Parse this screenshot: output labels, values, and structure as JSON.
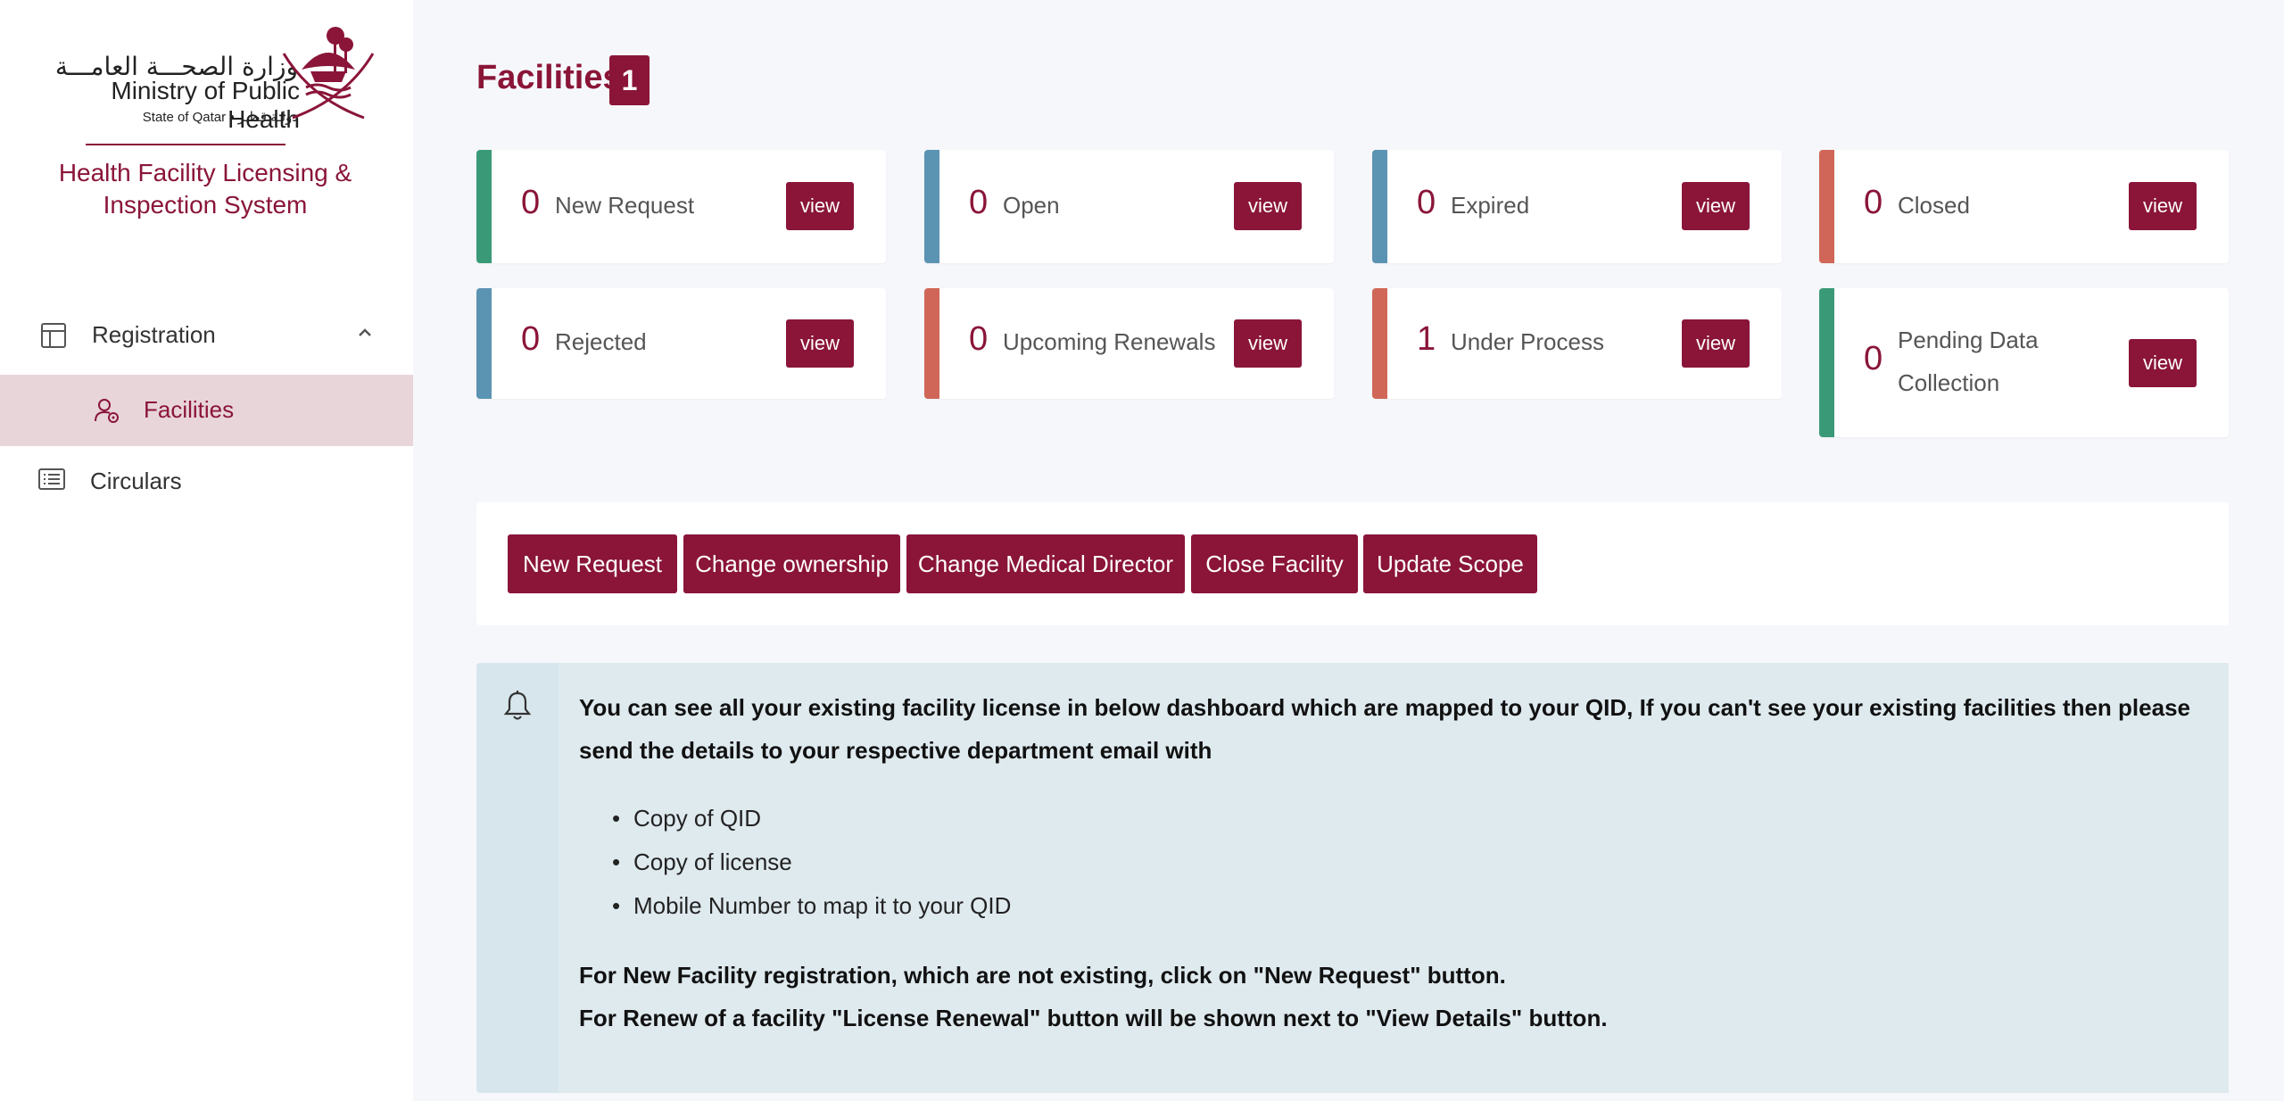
{
  "sidebar": {
    "logo": {
      "arabic": "وزارة الصحـــة العامـــة",
      "english": "Ministry of Public Health",
      "state": "State of Qatar • دولـة قطـر"
    },
    "system_title": "Health Facility Licensing & Inspection System",
    "items": [
      {
        "label": "Registration",
        "icon": "layout-icon"
      },
      {
        "label": "Facilities",
        "icon": "user-settings-icon"
      },
      {
        "label": "Circulars",
        "icon": "list-icon"
      }
    ]
  },
  "page": {
    "title": "Facilities",
    "badge": "1"
  },
  "cards": [
    {
      "count": "0",
      "label": "New Request",
      "button": "view",
      "color": "#3a9a78"
    },
    {
      "count": "0",
      "label": "Open",
      "button": "view",
      "color": "#5b93b3"
    },
    {
      "count": "0",
      "label": "Expired",
      "button": "view",
      "color": "#5b93b3"
    },
    {
      "count": "0",
      "label": "Closed",
      "button": "view",
      "color": "#d06657"
    },
    {
      "count": "0",
      "label": "Rejected",
      "button": "view",
      "color": "#5b93b3"
    },
    {
      "count": "0",
      "label": "Upcoming Renewals",
      "button": "view",
      "color": "#d06657"
    },
    {
      "count": "1",
      "label": "Under Process",
      "button": "view",
      "color": "#d06657"
    },
    {
      "count": "0",
      "label": "Pending Data",
      "label2": "Collection",
      "button": "view",
      "color": "#3a9a78"
    }
  ],
  "actions": [
    "New Request",
    "Change ownership",
    "Change Medical Director",
    "Close Facility",
    "Update Scope"
  ],
  "notice": {
    "text": "You can see all your existing facility license in below dashboard which are mapped to your QID, If you can't see your existing facilities then please send the details to your respective department email with",
    "items": [
      "Copy of QID",
      "Copy of license",
      "Mobile Number to map it to your QID"
    ],
    "footer1": "For New Facility registration, which are not existing, click on \"New Request\" button.",
    "footer2": "For Renew of a facility \"License Renewal\" button will be shown next to \"View Details\" button."
  },
  "colors": {
    "brand": "#8a1538",
    "green": "#3a9a78",
    "blue": "#5b93b3",
    "red": "#d06657"
  }
}
